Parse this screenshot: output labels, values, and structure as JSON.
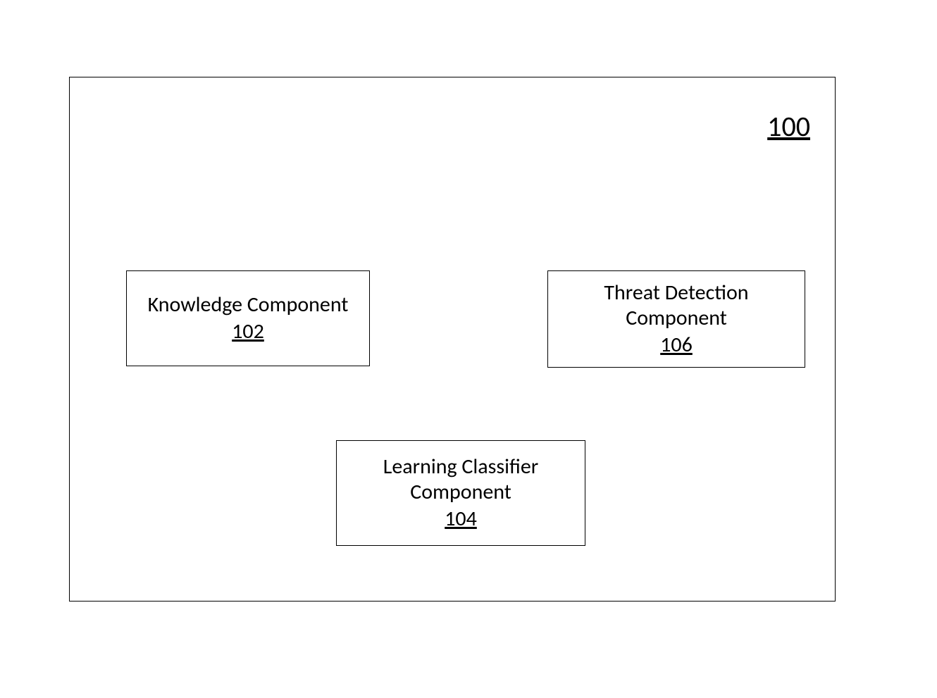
{
  "system": {
    "ref": "100"
  },
  "components": {
    "knowledge": {
      "title": "Knowledge Component",
      "ref": "102"
    },
    "threat": {
      "line1": "Threat Detection",
      "line2": "Component",
      "ref": "106"
    },
    "learning": {
      "line1": "Learning Classifier",
      "line2": "Component",
      "ref": "104"
    }
  }
}
